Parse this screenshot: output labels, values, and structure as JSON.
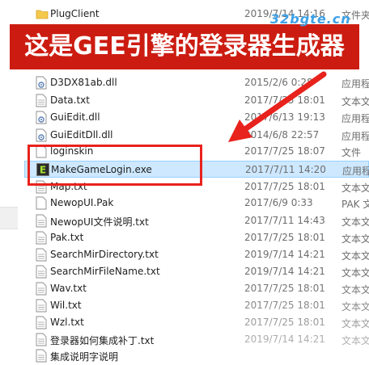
{
  "watermark": "32bgte.cn",
  "banner": "这是GEE引擎的登录器生成器",
  "files": [
    {
      "name": "PlugClient",
      "date": "2019/7/14 14:16",
      "type": "文件夹",
      "icon": "folder-icon"
    },
    {
      "name": "D3DX81ab.dll",
      "date": "2015/2/6 0:28",
      "type": "应用程",
      "icon": "dll-icon"
    },
    {
      "name": "Data.txt",
      "date": "2017/7/25 18:01",
      "type": "文本文",
      "icon": "text-file-icon"
    },
    {
      "name": "GuiEdit.dll",
      "date": "2017/6/13 19:13",
      "type": "应用程",
      "icon": "dll-icon"
    },
    {
      "name": "GuiEditDll.dll",
      "date": "2014/6/8 22:57",
      "type": "应用程",
      "icon": "dll-icon"
    },
    {
      "name": "loginskin",
      "date": "2017/7/25 18:07",
      "type": "文件",
      "icon": "blank-file-icon"
    },
    {
      "name": "MakeGameLogin.exe",
      "date": "2017/7/11 14:20",
      "type": "应用程",
      "icon": "exe-icon"
    },
    {
      "name": "Map.txt",
      "date": "2017/7/25 18:01",
      "type": "文本文",
      "icon": "text-file-icon"
    },
    {
      "name": "NewopUI.Pak",
      "date": "2017/6/9 0:33",
      "type": "PAK 文",
      "icon": "blank-file-icon"
    },
    {
      "name": "NewopUI文件说明.txt",
      "date": "2017/7/11 14:43",
      "type": "文本文",
      "icon": "text-file-icon"
    },
    {
      "name": "Pak.txt",
      "date": "2017/7/25 18:01",
      "type": "文本文",
      "icon": "text-file-icon"
    },
    {
      "name": "SearchMirDirectory.txt",
      "date": "2019/7/14 14:21",
      "type": "文本文",
      "icon": "text-file-icon"
    },
    {
      "name": "SearchMirFileName.txt",
      "date": "2019/7/14 14:21",
      "type": "文本文",
      "icon": "text-file-icon"
    },
    {
      "name": "Wav.txt",
      "date": "2017/7/25 18:01",
      "type": "文本文",
      "icon": "text-file-icon"
    },
    {
      "name": "Wil.txt",
      "date": "2017/7/25 18:01",
      "type": "文本文",
      "icon": "text-file-icon"
    },
    {
      "name": "Wzl.txt",
      "date": "2017/7/25 18:01",
      "type": "文本文",
      "icon": "text-file-icon"
    },
    {
      "name": "登录器如何集成补丁.txt",
      "date": "2019/7/14 14:21",
      "type": "文本文",
      "icon": "text-file-icon"
    },
    {
      "name": "集成说明字说明",
      "date": "",
      "type": "",
      "icon": "text-file-icon"
    }
  ]
}
